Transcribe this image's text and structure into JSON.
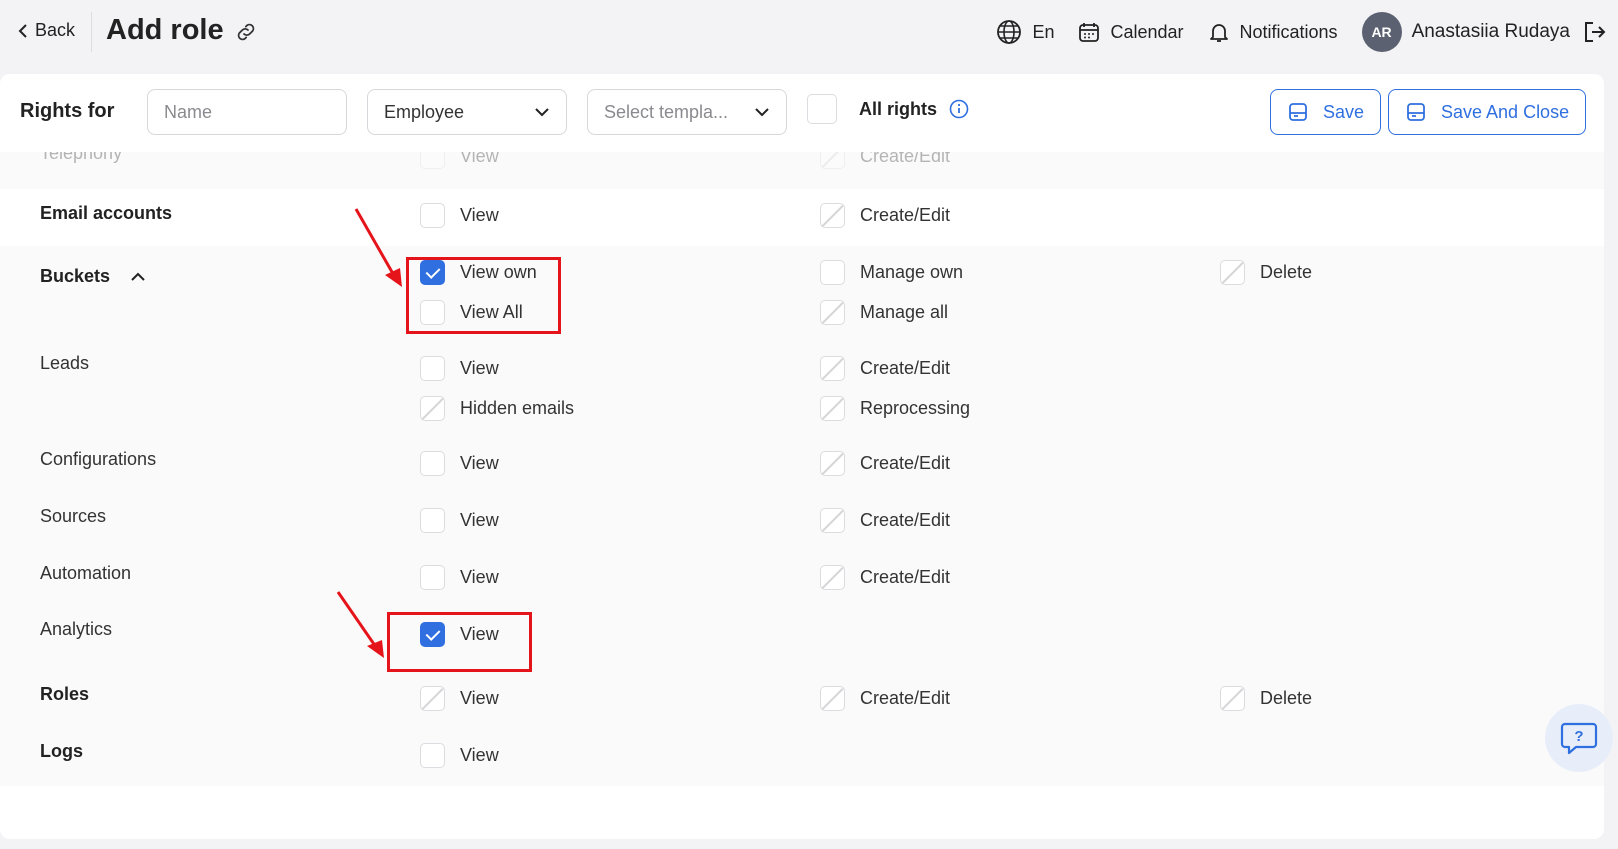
{
  "header": {
    "back_label": "Back",
    "page_title": "Add role",
    "language": "En",
    "calendar_label": "Calendar",
    "notifications_label": "Notifications",
    "user_initials": "AR",
    "user_name": "Anastasiia Rudaya"
  },
  "filters": {
    "rights_for_label": "Rights for",
    "name_placeholder": "Name",
    "role_type_value": "Employee",
    "template_placeholder": "Select templa...",
    "all_rights_label": "All rights",
    "save_label": "Save",
    "save_and_close_label": "Save And Close"
  },
  "permissions": {
    "telephony": {
      "label": "Telephony",
      "view": "View",
      "create_edit": "Create/Edit"
    },
    "email_accounts": {
      "label": "Email accounts",
      "view": "View",
      "create_edit": "Create/Edit"
    },
    "buckets": {
      "label": "Buckets",
      "view_own": "View own",
      "view_all": "View All",
      "manage_own": "Manage own",
      "manage_all": "Manage all",
      "delete": "Delete",
      "view_own_checked": true
    },
    "leads": {
      "label": "Leads",
      "view": "View",
      "create_edit": "Create/Edit",
      "hidden_emails": "Hidden emails",
      "reprocessing": "Reprocessing"
    },
    "configurations": {
      "label": "Configurations",
      "view": "View",
      "create_edit": "Create/Edit"
    },
    "sources": {
      "label": "Sources",
      "view": "View",
      "create_edit": "Create/Edit"
    },
    "automation": {
      "label": "Automation",
      "view": "View",
      "create_edit": "Create/Edit"
    },
    "analytics": {
      "label": "Analytics",
      "view": "View",
      "view_checked": true
    },
    "roles": {
      "label": "Roles",
      "view": "View",
      "create_edit": "Create/Edit",
      "delete": "Delete"
    },
    "logs": {
      "label": "Logs",
      "view": "View"
    }
  },
  "colors": {
    "accent": "#2f6fe0",
    "highlight": "#e5141b"
  }
}
